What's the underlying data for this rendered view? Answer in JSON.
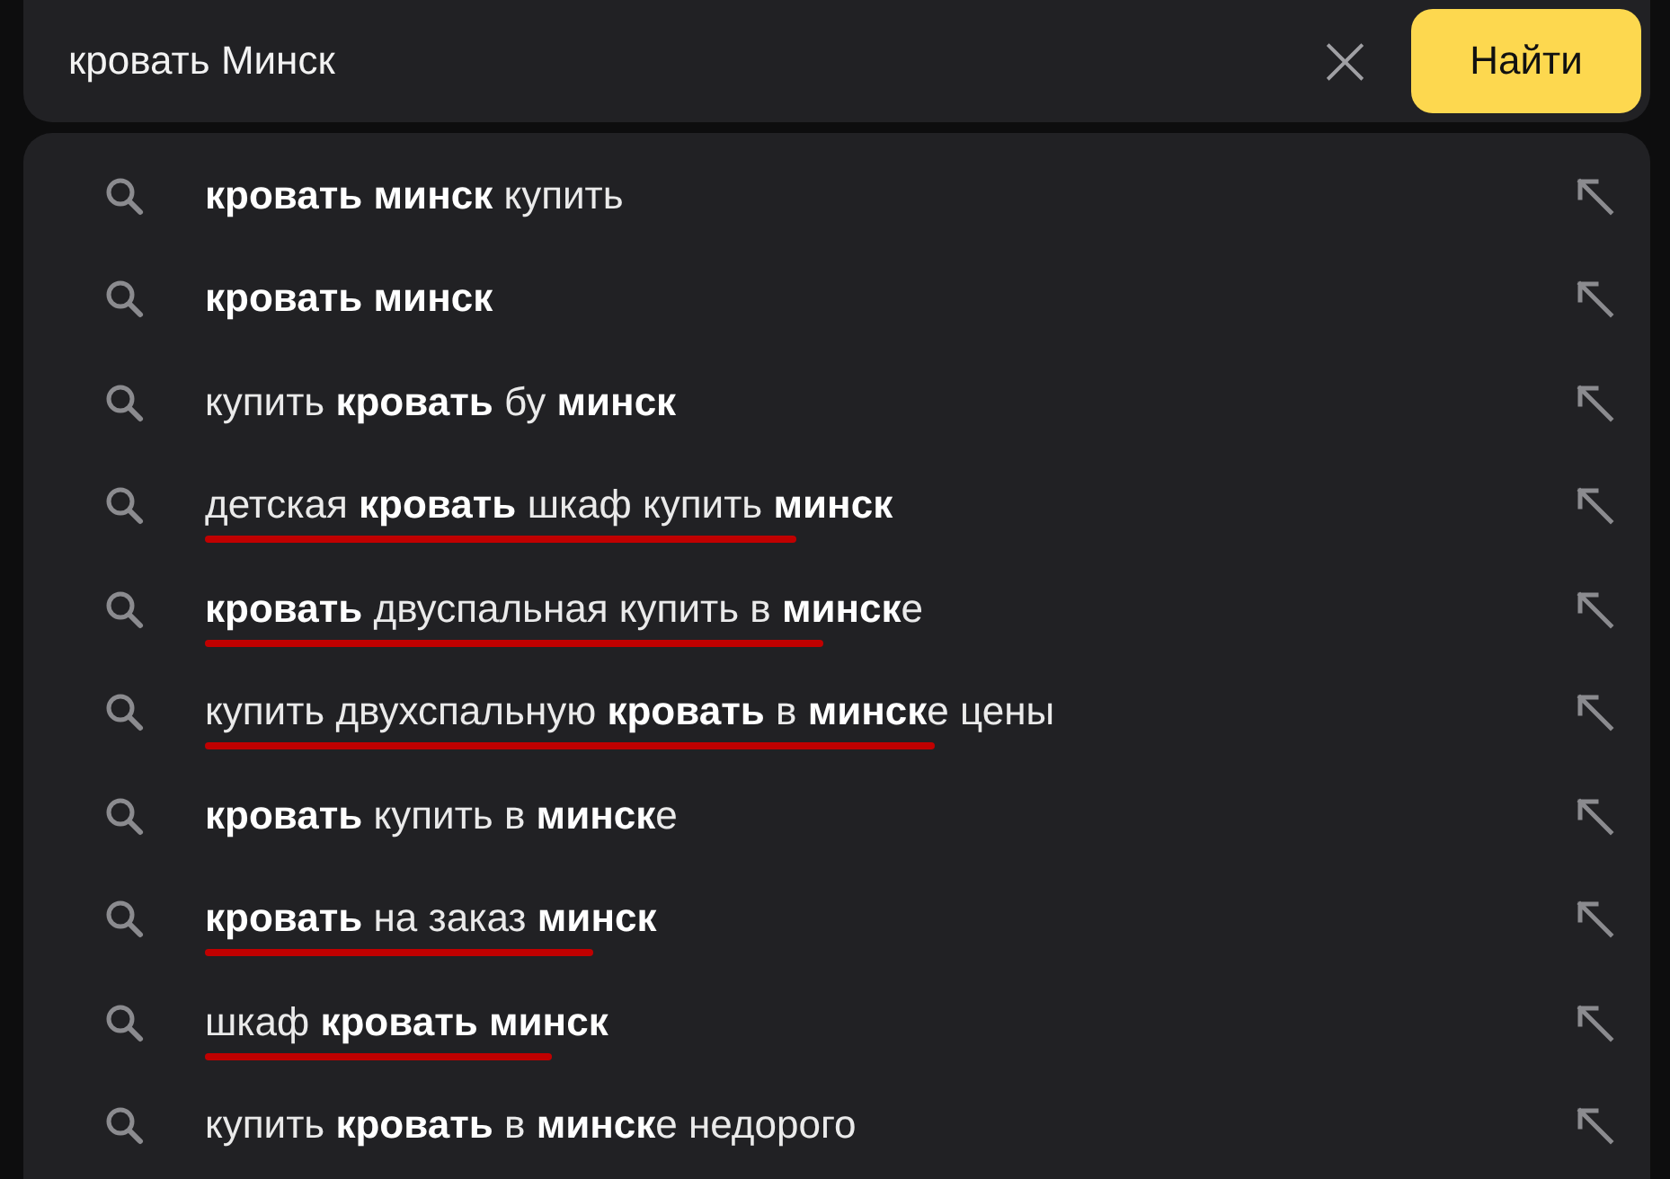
{
  "search": {
    "value": "кровать Минск",
    "clear": "×",
    "button": "Найти"
  },
  "suggestions": [
    {
      "text": "**кровать минск** купить",
      "underlined": false
    },
    {
      "text": "**кровать минск**",
      "underlined": false
    },
    {
      "text": "купить **кровать** бу **минск**",
      "underlined": false
    },
    {
      "text": "детская **кровать** шкаф купить **минск**",
      "underlined": true
    },
    {
      "text": "**кровать** двуспальная купить в **минск**е",
      "underlined": true
    },
    {
      "text": "купить двухспальную **кровать** в **минск**е цены",
      "underlined": true
    },
    {
      "text": "**кровать** купить в **минск**е",
      "underlined": false
    },
    {
      "text": "**кровать** на заказ **минск**",
      "underlined": true
    },
    {
      "text": "шкаф **кровать** **минск**",
      "underlined": true
    },
    {
      "text": "купить **кровать** в **минск**е недорого",
      "underlined": false
    }
  ]
}
